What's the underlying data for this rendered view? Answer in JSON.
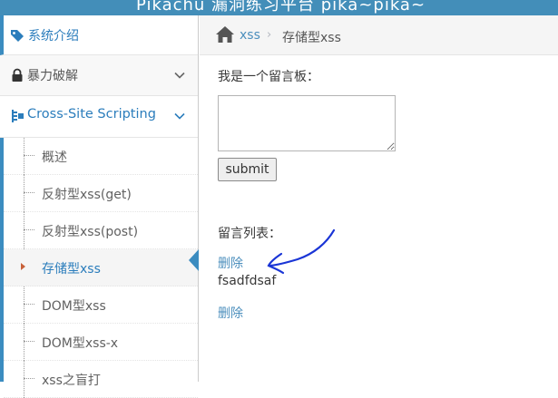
{
  "topbar": {
    "brand": "Pikachu 漏洞练习平台 pika~pika~"
  },
  "sidebar": {
    "intro_label": "系统介绍",
    "brute_label": "暴力破解",
    "xss_label": "Cross-Site Scripting",
    "sub_items": [
      "概述",
      "反射型xss(get)",
      "反射型xss(post)",
      "存储型xss",
      "DOM型xss",
      "DOM型xss-x",
      "xss之盲打"
    ],
    "active_index": 3
  },
  "breadcrumb": {
    "link": "xss",
    "separator": "›",
    "current": "存储型xss"
  },
  "content": {
    "board_title": "我是一个留言板：",
    "textarea_value": "",
    "submit_label": "submit",
    "list_title": "留言列表：",
    "messages": [
      {
        "delete_label": "删除",
        "text": "fsadfdsaf"
      },
      {
        "delete_label": "删除",
        "text": ""
      }
    ]
  },
  "colors": {
    "accent": "#438eb9",
    "link": "#4c8fbd",
    "annotation": "#1a35d6"
  }
}
